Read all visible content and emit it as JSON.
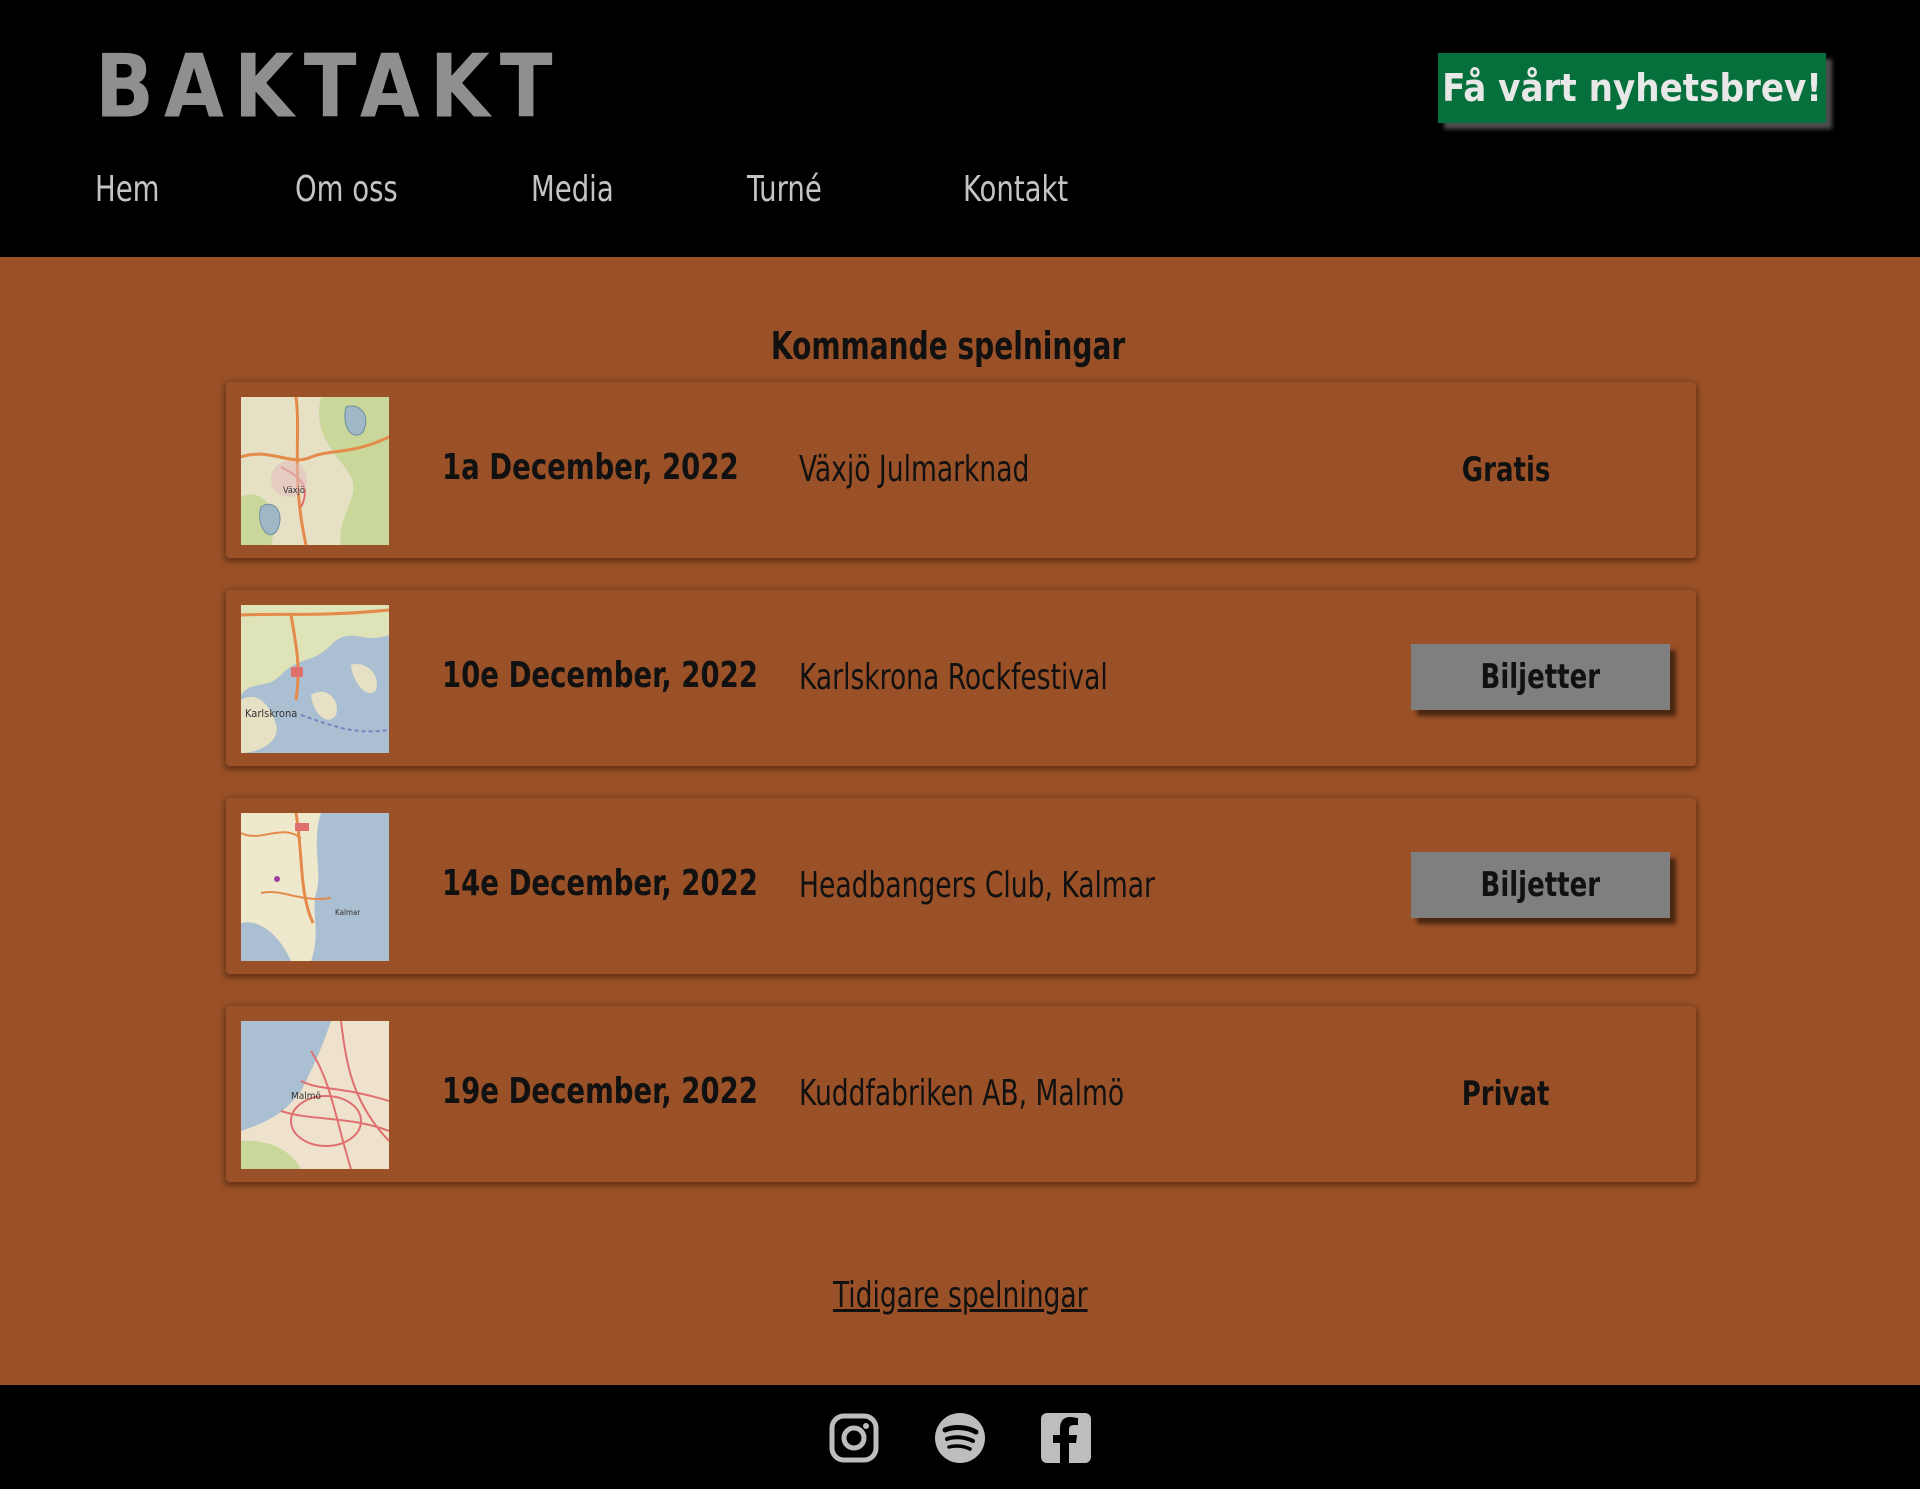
{
  "header": {
    "logo": "BAKTAKT",
    "newsletter_label": "Få vårt nyhetsbrev!",
    "nav": [
      "Hem",
      "Om oss",
      "Media",
      "Turné",
      "Kontakt"
    ]
  },
  "main": {
    "title": "Kommande spelningar",
    "gigs": [
      {
        "date": "1a December, 2022",
        "venue": "Växjö Julmarknad",
        "status": "Gratis",
        "map_label": "Växjö"
      },
      {
        "date": "10e December, 2022",
        "venue": "Karlskrona Rockfestival",
        "ticket_label": "Biljetter",
        "map_label": "Karlskrona"
      },
      {
        "date": "14e December, 2022",
        "venue": "Headbangers Club, Kalmar",
        "ticket_label": "Biljetter",
        "map_label": "Kalmar"
      },
      {
        "date": "19e December, 2022",
        "venue": "Kuddfabriken AB, Malmö",
        "status": "Privat",
        "map_label": "Malmö"
      }
    ],
    "earlier_link": "Tidigare spelningar"
  },
  "footer": {
    "social_icons": [
      "instagram-icon",
      "spotify-icon",
      "facebook-icon"
    ]
  },
  "colors": {
    "page_background": "#9b5127",
    "header_background": "#000000",
    "newsletter_button": "#05703b",
    "ticket_button": "#7f7f7f",
    "logo": "#8f8f8f",
    "nav_text": "#c4c4c4"
  }
}
